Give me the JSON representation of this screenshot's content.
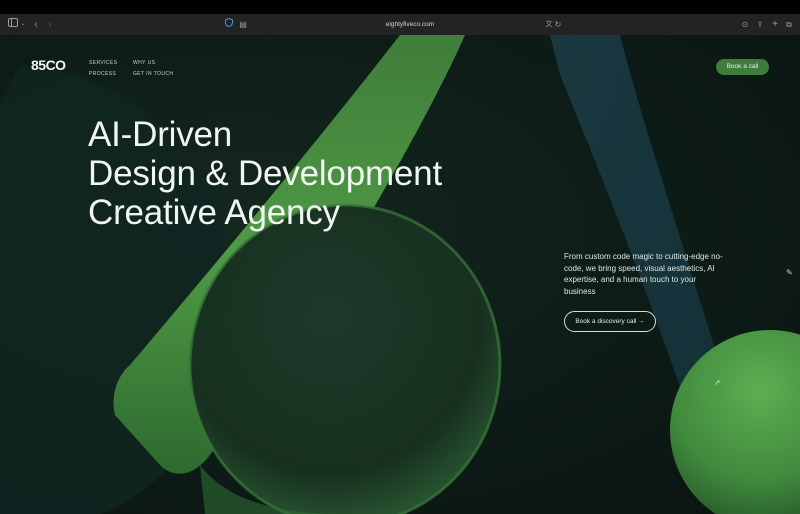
{
  "browser": {
    "url": "eightyfiveco.com",
    "icons": {
      "sidebar": "sidebar-icon",
      "back": "back-icon",
      "forward": "forward-icon",
      "shield": "shield-icon",
      "reader": "reader-icon",
      "translate": "translate-icon",
      "reload": "reload-icon",
      "download": "download-icon",
      "share": "share-icon",
      "new_tab": "plus-icon",
      "tabs": "tabs-overview-icon"
    }
  },
  "site": {
    "logo": "85CO",
    "nav": [
      "SERVICES",
      "WHY US",
      "PROCESS",
      "GET IN TOUCH"
    ],
    "cta_top": "Book a call",
    "hero_lines": [
      "AI-Driven",
      "Design & Development",
      "Creative Agency"
    ],
    "subtitle": "From custom code magic to cutting-edge no-code, we bring speed, visual aesthetics, AI expertise, and a human touch to your business",
    "cta_secondary": "Book a discovery call →",
    "colors": {
      "accent": "#3d7c3b",
      "background": "#0d1714"
    }
  }
}
